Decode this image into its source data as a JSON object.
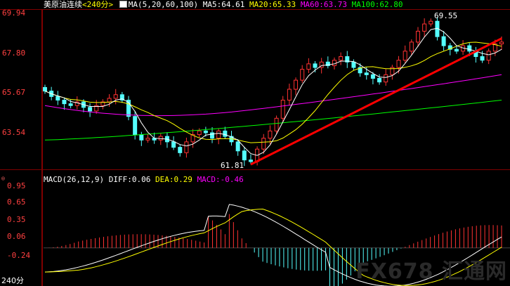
{
  "chart_header": {
    "instrument": "美原油连续",
    "period": "<240分>",
    "ma_group": "MA(5,20,60,100)",
    "ma5": "MA5:64.61",
    "ma20": "MA20:65.33",
    "ma60": "MA60:63.73",
    "ma100": "MA100:62.80"
  },
  "macd_header": {
    "macd_params": "MACD(26,12,9)",
    "diff": "DIFF:0.06",
    "dea": "DEA:0.29",
    "macd": "MACD:-0.46"
  },
  "footer": {
    "period": "240分"
  },
  "watermark": "FX678 汇通网",
  "colors": {
    "up": "#ff3232",
    "down": "#54ffff",
    "ma5": "#ffffff",
    "ma20": "#ffff00",
    "ma60": "#ff00ff",
    "ma100": "#00ff00",
    "trend": "#ff0000",
    "axis": "#ff0000",
    "diff": "#ffffff",
    "dea": "#ffff00"
  },
  "chart_data": [
    {
      "type": "candlestick",
      "title": "美原油连续 <240分>",
      "yticks": [
        "69.94",
        "67.80",
        "65.67",
        "63.54"
      ],
      "ylim": [
        61.5,
        70.1
      ],
      "annotations": [
        {
          "label": "69.55",
          "value": 69.55
        },
        {
          "label": "61.81",
          "value": 61.81
        }
      ],
      "series": [
        {
          "name": "MA5",
          "value": 64.61
        },
        {
          "name": "MA20",
          "value": 65.33
        },
        {
          "name": "MA60",
          "value": 63.73
        },
        {
          "name": "MA100",
          "value": 62.8
        }
      ],
      "closes": [
        65.7,
        65.4,
        65.2,
        65.0,
        64.9,
        65.1,
        64.8,
        64.6,
        64.9,
        65.1,
        65.3,
        65.5,
        65.2,
        64.3,
        63.3,
        63.0,
        63.1,
        63.0,
        63.2,
        62.9,
        62.6,
        62.3,
        62.9,
        63.3,
        63.5,
        63.4,
        63.1,
        63.5,
        63.2,
        62.9,
        62.4,
        61.9,
        61.81,
        62.5,
        63.1,
        63.5,
        64.2,
        65.2,
        65.8,
        66.3,
        66.9,
        67.2,
        67.0,
        67.3,
        67.1,
        67.4,
        67.6,
        67.3,
        67.0,
        66.7,
        66.6,
        66.4,
        66.2,
        66.6,
        67.0,
        67.4,
        67.9,
        68.4,
        69.0,
        69.4,
        69.55,
        68.7,
        68.2,
        68.0,
        67.9,
        68.2,
        67.9,
        67.6,
        67.4,
        67.9,
        68.3,
        68.4
      ]
    },
    {
      "type": "bar",
      "title": "MACD(26,12,9)",
      "yticks": [
        "0.95",
        "0.65",
        "0.35",
        "0.06",
        "-0.24"
      ],
      "ylim": [
        -0.52,
        1.0
      ],
      "series": [
        {
          "name": "DIFF",
          "value": 0.06
        },
        {
          "name": "DEA",
          "value": 0.29
        },
        {
          "name": "MACD",
          "value": -0.46
        }
      ]
    }
  ]
}
